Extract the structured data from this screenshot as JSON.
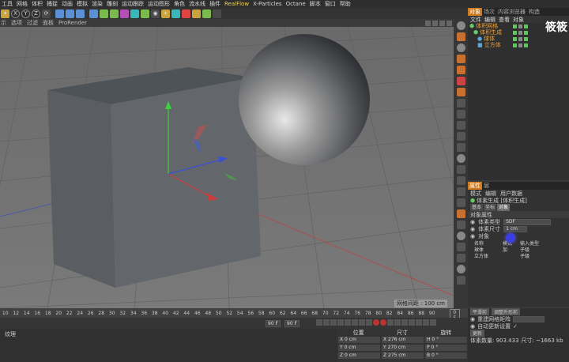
{
  "menubar": {
    "items": [
      "工具",
      "网格",
      "体积",
      "捕捉",
      "动画",
      "模拟",
      "渲染",
      "雕刻",
      "运动跟踪",
      "运动图形",
      "角色",
      "流水线",
      "插件",
      "RealFlow",
      "X-Particles",
      "Octane",
      "脚本",
      "窗口",
      "帮助"
    ]
  },
  "toolbar": {
    "axes": [
      "X",
      "Y",
      "Z"
    ]
  },
  "viewport_menu": {
    "items": [
      "示",
      "选项",
      "过滤",
      "面板",
      "ProRender"
    ]
  },
  "viewport": {
    "grid_label": "网格间距 : 100 cm"
  },
  "object_panel": {
    "tabs": [
      "对象",
      "场次",
      "内容浏览器",
      "构造"
    ],
    "menu": [
      "文件",
      "编辑",
      "查看",
      "对象"
    ],
    "tree": [
      {
        "label": "体积网格"
      },
      {
        "label": "体积生成"
      },
      {
        "label": "球体"
      },
      {
        "label": "立方体"
      }
    ],
    "overlay_text": "筱筱"
  },
  "attr_panel": {
    "tabs": [
      "属性",
      "层"
    ],
    "menu": [
      "模式",
      "编辑",
      "用户数据"
    ],
    "object_name": "体素生成 [体积生成]",
    "subtabs": [
      "基本",
      "坐标",
      "对象"
    ],
    "section": "对象属性",
    "voxel_type_label": "体素类型",
    "voxel_type_value": "SDF",
    "voxel_size_label": "体素尺寸",
    "voxel_size_value": "1 cm",
    "objects_label": "对象",
    "table_headers": [
      "名称",
      "模式",
      "输入类型"
    ],
    "table_rows": [
      {
        "name": "球体",
        "mode": "加",
        "input": "子级"
      },
      {
        "name": "立方体",
        "mode": "",
        "input": "子级"
      }
    ]
  },
  "timeline": {
    "ticks": [
      "10",
      "12",
      "14",
      "16",
      "18",
      "20",
      "22",
      "24",
      "26",
      "28",
      "30",
      "32",
      "34",
      "36",
      "38",
      "40",
      "42",
      "44",
      "46",
      "48",
      "50",
      "52",
      "54",
      "56",
      "58",
      "60",
      "62",
      "64",
      "66",
      "68",
      "70",
      "72",
      "74",
      "76",
      "78",
      "80",
      "82",
      "84",
      "86",
      "88",
      "90"
    ],
    "current_frame": "0 F"
  },
  "transport": {
    "end_frame": "90 F",
    "end_frame2": "90 F"
  },
  "right_bottom": {
    "buttons": [
      "平滑前",
      "调整外形前"
    ],
    "mesh_label": "重建网格矩阵",
    "auto_update": "自动更新设置",
    "update_btn": "更新",
    "voxel_count": "体素数量: 903.433",
    "size_label": "尺寸: ~1663 kb"
  },
  "material": {
    "label": "纹理"
  },
  "coords": {
    "headers": [
      "位置",
      "尺寸",
      "旋转"
    ],
    "rows": [
      {
        "pos": "X  0 cm",
        "size": "X  276 cm",
        "rot": "H  0 °"
      },
      {
        "pos": "Y  0 cm",
        "size": "Y  270 cm",
        "rot": "P  0 °"
      },
      {
        "pos": "Z  0 cm",
        "size": "Z  275 cm",
        "rot": "B  0 °"
      }
    ]
  }
}
